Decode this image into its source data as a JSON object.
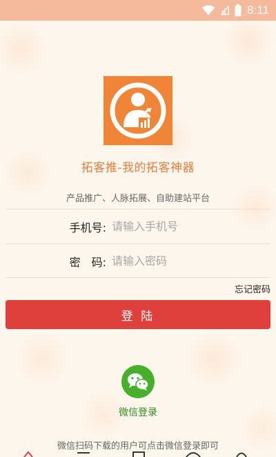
{
  "status_bar": {
    "time": "8:11",
    "icons": [
      "wifi-icon",
      "cellular-icon",
      "battery-icon"
    ]
  },
  "app": {
    "title": "拓客推-我的拓客神器",
    "subtitle": "产品推广、人脉拓展、自助建站平台",
    "logo_icon": "user-growth-icon"
  },
  "form": {
    "phone_label": "手机号:",
    "phone_placeholder": "请输入手机号",
    "password_label": "密　码:",
    "password_placeholder": "请输入密码",
    "forgot_password": "忘记密码",
    "login_button": "登 陆"
  },
  "wechat": {
    "icon": "wechat-icon",
    "label": "微信登录",
    "hint": "微信扫码下载的用户可点击微信登录即可"
  },
  "bottom_nav": {
    "icons": [
      "nav-icon-1",
      "nav-icon-2",
      "nav-icon-3",
      "nav-icon-4",
      "nav-icon-5",
      "nav-icon-6"
    ]
  },
  "colors": {
    "status_bar": "#f5b99b",
    "brand_orange": "#f08538",
    "title_orange": "#ed7d3a",
    "login_red": "#e0403b",
    "wechat_green": "#46b02b",
    "background": "#fdf6ec"
  }
}
